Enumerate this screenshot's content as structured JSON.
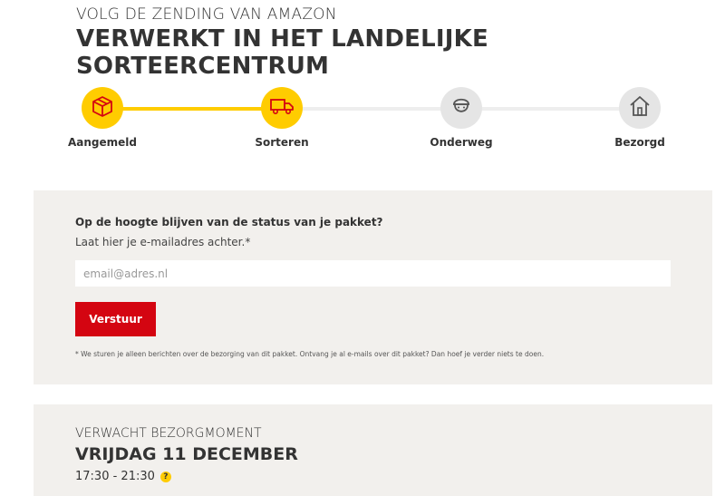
{
  "header": {
    "subtitle": "VOLG DE ZENDING VAN AMAZON",
    "title": "VERWERKT IN HET LANDELIJKE SORTEERCENTRUM"
  },
  "tracker": {
    "steps": [
      {
        "label": "Aangemeld",
        "icon": "package-icon",
        "state": "done"
      },
      {
        "label": "Sorteren",
        "icon": "truck-icon",
        "state": "current"
      },
      {
        "label": "Onderweg",
        "icon": "courier-icon",
        "state": "pending"
      },
      {
        "label": "Bezorgd",
        "icon": "house-icon",
        "state": "pending"
      }
    ],
    "accent_color": "#ffcc00",
    "inactive_color": "#e5e5e5"
  },
  "notify": {
    "question": "Op de hoogte blijven van de status van je pakket?",
    "instruction": "Laat hier je e-mailadres achter.*",
    "email_placeholder": "email@adres.nl",
    "email_value": "",
    "submit_label": "Verstuur",
    "disclaimer": "* We sturen je alleen berichten over de bezorging van dit pakket. Ontvang je al e-mails over dit pakket? Dan hoef je verder niets te doen.",
    "button_color": "#d40511"
  },
  "delivery": {
    "label": "VERWACHT BEZORGMOMENT",
    "date": "VRIJDAG 11 DECEMBER",
    "time": "17:30 - 21:30",
    "help_icon": "question-icon",
    "help_symbol": "?"
  }
}
